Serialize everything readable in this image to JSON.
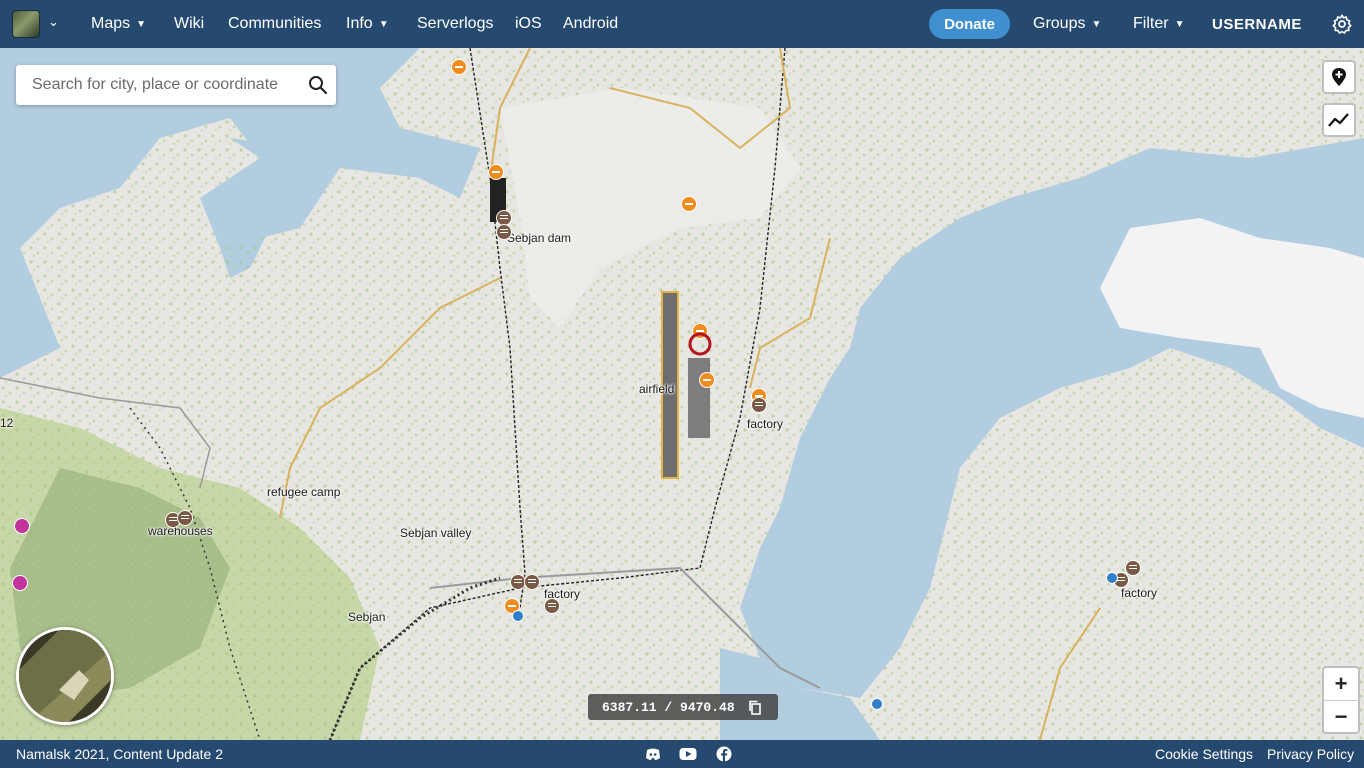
{
  "nav": {
    "maps": "Maps",
    "wiki": "Wiki",
    "communities": "Communities",
    "info": "Info",
    "serverlogs": "Serverlogs",
    "ios": "iOS",
    "android": "Android",
    "donate": "Donate",
    "groups": "Groups",
    "filter": "Filter",
    "username": "USERNAME"
  },
  "search": {
    "placeholder": "Search for city, place or coordinate"
  },
  "map": {
    "labels": {
      "sebjan_dam": "Sebjan dam",
      "airfield": "airfield",
      "factory_east": "factory",
      "refugee_camp": "refugee camp",
      "warehouses": "warehouses",
      "sebjan_valley": "Sebjan valley",
      "factory_south": "factory",
      "factory_island": "factory",
      "sebjan": "Sebjan",
      "grid_edge": "12"
    },
    "coordinates": "6387.11 / 9470.48"
  },
  "zoom": {
    "in": "+",
    "out": "−"
  },
  "footer": {
    "version": "Namalsk 2021, Content Update 2",
    "cookie": "Cookie Settings",
    "privacy": "Privacy Policy"
  },
  "colors": {
    "header": "#25496f",
    "donate": "#3f8fd1",
    "water": "#b3cde0",
    "land": "#e7e6e2"
  }
}
